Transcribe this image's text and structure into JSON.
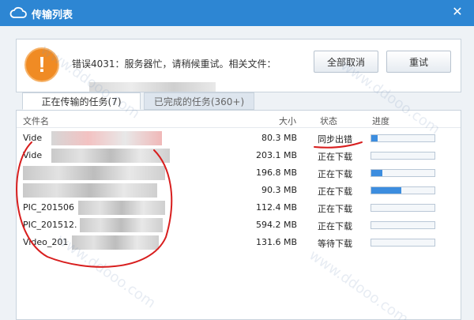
{
  "window": {
    "title": "传输列表",
    "close_icon": "close-icon"
  },
  "error": {
    "icon": "warning-icon",
    "text": "错误4031：服务器忙，请稍候重试。相关文件：",
    "cancel_all_label": "全部取消",
    "retry_label": "重试"
  },
  "tabs": [
    {
      "label": "正在传输的任务(7)",
      "active": true
    },
    {
      "label": "已完成的任务(360+)",
      "active": false
    }
  ],
  "columns": {
    "name": "文件名",
    "size": "大小",
    "status": "状态",
    "progress": "进度"
  },
  "rows": [
    {
      "name": "Vide",
      "size": "80.3 MB",
      "status": "同步出错",
      "progress": 0.1
    },
    {
      "name": "Vide",
      "size": "203.1 MB",
      "status": "正在下载",
      "progress": 0.0
    },
    {
      "name": "",
      "size": "196.8 MB",
      "status": "正在下载",
      "progress": 0.18
    },
    {
      "name": "",
      "size": "90.3 MB",
      "status": "正在下载",
      "progress": 0.48
    },
    {
      "name": "PIC_201506",
      "size": "112.4 MB",
      "status": "正在下载",
      "progress": 0.0
    },
    {
      "name": "PIC_201512.",
      "size": "594.2 MB",
      "status": "正在下载",
      "progress": 0.0
    },
    {
      "name": "Video_201",
      "size": "131.6 MB",
      "status": "等待下载",
      "progress": 0.0
    }
  ],
  "colors": {
    "titlebar": "#2d86d3",
    "progress_fill": "#3c8ddf",
    "warning": "#f08b24",
    "annotation": "#d81e1e"
  }
}
